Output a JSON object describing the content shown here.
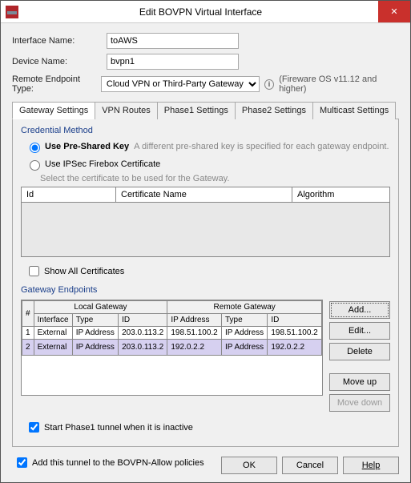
{
  "window": {
    "title": "Edit BOVPN Virtual Interface"
  },
  "form": {
    "iface_label": "Interface Name:",
    "iface_value": "toAWS",
    "device_label": "Device Name:",
    "device_value": "bvpn1",
    "ret_label": "Remote Endpoint Type:",
    "ret_value": "Cloud VPN or Third-Party Gateway",
    "ret_hint": "(Fireware OS v11.12 and higher)"
  },
  "tabs": {
    "t0": "Gateway Settings",
    "t1": "VPN Routes",
    "t2": "Phase1 Settings",
    "t3": "Phase2 Settings",
    "t4": "Multicast Settings"
  },
  "cred": {
    "title": "Credential Method",
    "r1": "Use Pre-Shared Key",
    "r1_hint": "A different pre-shared key is specified for each gateway endpoint.",
    "r2": "Use IPSec Firebox Certificate",
    "sub": "Select the certificate to be used for the Gateway.",
    "col_id": "Id",
    "col_name": "Certificate Name",
    "col_alg": "Algorithm",
    "show_all": "Show All Certificates"
  },
  "ep": {
    "title": "Gateway Endpoints",
    "h_num": "#",
    "h_local": "Local Gateway",
    "h_remote": "Remote Gateway",
    "h_iface": "Interface",
    "h_type": "Type",
    "h_id": "ID",
    "h_ip": "IP Address",
    "rows": [
      {
        "n": "1",
        "iface": "External",
        "ltype": "IP Address",
        "lid": "203.0.113.2",
        "rip": "198.51.100.2",
        "rtype": "IP Address",
        "rid": "198.51.100.2"
      },
      {
        "n": "2",
        "iface": "External",
        "ltype": "IP Address",
        "lid": "203.0.113.2",
        "rip": "192.0.2.2",
        "rtype": "IP Address",
        "rid": "192.0.2.2"
      }
    ],
    "b_add": "Add...",
    "b_edit": "Edit...",
    "b_del": "Delete",
    "b_up": "Move up",
    "b_down": "Move down",
    "start": "Start Phase1 tunnel when it is inactive"
  },
  "bottom": {
    "allow": "Add this tunnel to the BOVPN-Allow policies"
  },
  "footer": {
    "ok": "OK",
    "cancel": "Cancel",
    "help": "Help"
  }
}
